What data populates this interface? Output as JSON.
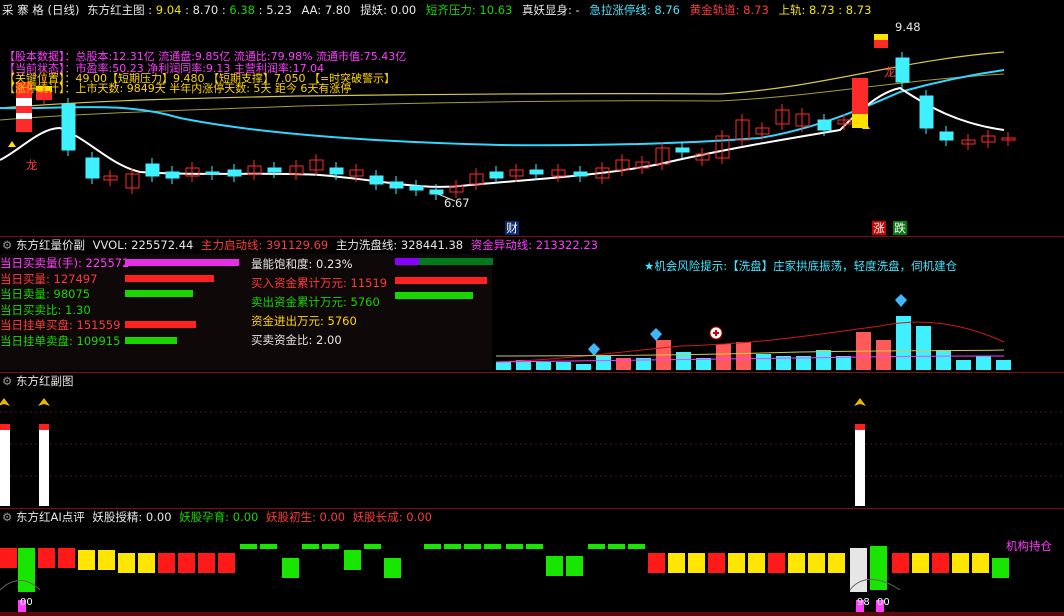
{
  "main_header": {
    "period_title": "采 寨 格 (日线)",
    "indicator_name": "东方红主图",
    "vals": [
      "9.04",
      "8.70",
      "6.38",
      "5.23"
    ],
    "aa_label": "AA: 7.80",
    "tiyao_label": "提妖: 0.00",
    "duanqi_label": "短齐压力: 10.63",
    "zhenyao_label": "真妖显身: -",
    "jila_label": "急拉涨停线: 8.76",
    "huangjin_label": "黄金轨道: 8.73",
    "shanggui_label": "上轨: 8.73 : 8.73"
  },
  "info_lines": {
    "l1": "【股本数据】：总股本:12.31亿 流通盘:9.85亿 流通比:79.98% 流通市值:75.43亿",
    "l2": "【当前状态】：市盈率:50.23 净利润同率:9.13 主营利润率:17.04",
    "l3": "【关键位置】：49.00【短期压力】9.480 【短期支撑】7.050 【=时突破警示】",
    "l4": "【涨停统计】：上市天数: 9849天 半年内涨停天数: 5天 距今 6天有涨停"
  },
  "price_annotations": {
    "high": "9.48",
    "low": "6.67",
    "long_left": "龙",
    "long_right": "龙",
    "cai": "财",
    "zhang": "涨",
    "die": "跌"
  },
  "vol_header": {
    "name": "东方红量价副",
    "vvol": "VVOL: 225572.44",
    "zhuli_qidong": "主力启动线: 391129.69",
    "zhuli_xipan": "主力洗盘线: 328441.38",
    "zijin_yidong": "资金异动线: 213322.23"
  },
  "vol_left": [
    {
      "label": "当日买卖量(手): 225572",
      "color": "#ff3cff",
      "bar": "#e62ee6",
      "frac": 1.0
    },
    {
      "label": "当日买量: 127497",
      "color": "#ff3a3a",
      "bar": "#ff2020",
      "frac": 0.78
    },
    {
      "label": "当日卖量: 98075",
      "color": "#19d600",
      "bar": "#19d600",
      "frac": 0.6
    },
    {
      "label": "当日买卖比: 1.30",
      "color": "#19d600",
      "bar": "",
      "frac": 0
    },
    {
      "label": "当日挂单买盘: 151559",
      "color": "#ff3a3a",
      "bar": "#ff2020",
      "frac": 0.62
    },
    {
      "label": "当日挂单卖盘: 109915",
      "color": "#19d600",
      "bar": "#19d600",
      "frac": 0.46
    }
  ],
  "vol_mid": [
    {
      "label": "量能饱和度: 0.23%",
      "color": "#e6e6e6"
    },
    {
      "label": "买入资金累计万元: 11519",
      "color": "#ff3a3a"
    },
    {
      "label": "卖出资金累计万元: 5760",
      "color": "#19d600"
    },
    {
      "label": "资金进出万元: 5760",
      "color": "#ffd400"
    },
    {
      "label": "买卖资金比: 2.00",
      "color": "#e6e6e6"
    }
  ],
  "risk_hint": "★机会风险提示:【洗盘】庄家拱底振荡，轻度洗盘，伺机建仓",
  "sub_header": {
    "name": "东方红副图"
  },
  "ai_header": {
    "name": "东方红AI点评",
    "yao_shou": "妖股授精: 0.00",
    "yao_yun": "妖股孕育: 0.00",
    "yao_chu": "妖股初生: 0.00",
    "yao_zhang": "妖股长成: 0.00"
  },
  "ai_right_label": "机构持仓",
  "ai_bottom_labels": [
    "00",
    "98",
    "00"
  ],
  "colors": {
    "up": "#ff2a2a",
    "down": "#3ff0ff",
    "ma_white": "#ffffff",
    "ma_cyan": "#33d6ff",
    "ma_yellow": "#d4c84a",
    "separator": "#7a1010"
  },
  "icons": [
    "flower-icon",
    "diamond-icon",
    "plus-coin-icon",
    "lightning-icon"
  ]
}
